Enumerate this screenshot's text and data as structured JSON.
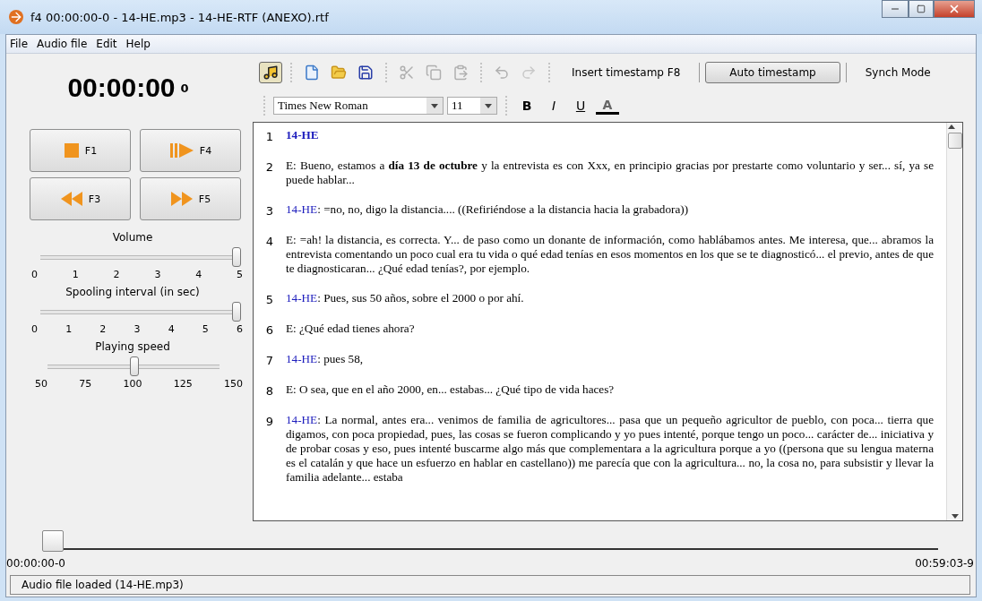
{
  "window": {
    "title": "f4 00:00:00-0 - 14-HE.mp3 - 14-HE-RTF (ANEXO).rtf"
  },
  "menu": [
    "File",
    "Audio file",
    "Edit",
    "Help"
  ],
  "timer": {
    "time": "00:00:00",
    "tenths": "0"
  },
  "transport": [
    {
      "kind": "stop",
      "label": "F1"
    },
    {
      "kind": "play",
      "label": "F4"
    },
    {
      "kind": "rewind",
      "label": "F3"
    },
    {
      "kind": "forward",
      "label": "F5"
    }
  ],
  "sliders": [
    {
      "label": "Volume",
      "level": 1,
      "ticks": [
        "0",
        "1",
        "2",
        "3",
        "4",
        "5"
      ]
    },
    {
      "label": "Spooling interval (in sec)",
      "level": 1,
      "ticks": [
        "0",
        "1",
        "2",
        "3",
        "4",
        "5",
        "6"
      ]
    },
    {
      "label": "Playing speed",
      "level": 0.5,
      "ticks": [
        "50",
        "75",
        "100",
        "125",
        "150"
      ]
    }
  ],
  "toolbar": [
    {
      "kind": "load-audio",
      "selected": true,
      "disabled": false
    },
    {
      "kind": "sep"
    },
    {
      "kind": "new",
      "selected": false,
      "disabled": false
    },
    {
      "kind": "open",
      "selected": false,
      "disabled": false
    },
    {
      "kind": "save",
      "selected": false,
      "disabled": false
    },
    {
      "kind": "sep"
    },
    {
      "kind": "cut",
      "selected": false,
      "disabled": true
    },
    {
      "kind": "copy",
      "selected": false,
      "disabled": true
    },
    {
      "kind": "paste",
      "selected": false,
      "disabled": true
    },
    {
      "kind": "sep"
    },
    {
      "kind": "undo",
      "selected": false,
      "disabled": true
    },
    {
      "kind": "redo",
      "selected": false,
      "disabled": true
    },
    {
      "kind": "sep"
    },
    {
      "kind": "text",
      "label": "Insert timestamp F8",
      "selected": false
    },
    {
      "kind": "bar"
    },
    {
      "kind": "text",
      "label": "Auto timestamp",
      "selected": true
    },
    {
      "kind": "bar"
    },
    {
      "kind": "text",
      "label": "Synch Mode",
      "selected": false
    }
  ],
  "format": {
    "font": "Times New Roman",
    "size": "11",
    "styles": [
      {
        "kind": "bold",
        "label": "B"
      },
      {
        "kind": "italic",
        "label": "I"
      },
      {
        "kind": "underline",
        "label": "U"
      },
      {
        "kind": "color",
        "label": "A"
      }
    ]
  },
  "paragraphs": [
    {
      "number": "1",
      "kind": "heading",
      "text": "14-HE"
    },
    {
      "number": "2",
      "kind": "plain",
      "text": "E: Bueno, estamos a **día 13 de octubre** y la entrevista es con Xxx, en principio gracias por prestarte como voluntario y ser... sí, ya se puede hablar..."
    },
    {
      "number": "3",
      "kind": "speaker",
      "speaker": "14-HE",
      "text": ": =no, no, digo la distancia.... ((Refiriéndose a la distancia hacia la grabadora))"
    },
    {
      "number": "4",
      "kind": "plain",
      "text": "E: =ah! la distancia, es correcta. Y... de paso como un donante de información, como hablábamos antes. Me interesa, que... abramos la entrevista comentando un poco cual era tu vida o qué edad tenías en esos momentos en los que se te diagnosticó... el previo, antes de que te diagnosticaran... ¿Qué edad tenías?, por ejemplo."
    },
    {
      "number": "5",
      "kind": "speaker",
      "speaker": "14-HE",
      "text": ": Pues, sus 50 años, sobre el 2000 o por ahí."
    },
    {
      "number": "6",
      "kind": "plain",
      "text": "E: ¿Qué edad tienes ahora?"
    },
    {
      "number": "7",
      "kind": "speaker",
      "speaker": "14-HE",
      "text": ": pues 58,"
    },
    {
      "number": "8",
      "kind": "plain",
      "text": "E: O sea, que en el año 2000, en... estabas... ¿Qué tipo de vida haces?"
    },
    {
      "number": "9",
      "kind": "speaker",
      "speaker": "14-HE",
      "text": ": La normal, antes era... venimos de familia de agricultores... pasa que un pequeño agricultor de pueblo, con poca... tierra que digamos, con poca propiedad, pues, las cosas se fueron complicando y yo pues intenté, porque tengo un poco... carácter de... iniciativa y de probar cosas y eso, pues intenté buscarme algo más que complementara a la agricultura porque a yo ((persona que su lengua materna es el catalán y que hace un esfuerzo en hablar en castellano)) me parecía que con la agricultura... no, la cosa no, para subsistir y llevar la familia adelante... estaba"
    }
  ],
  "position": {
    "level": 0,
    "start": "00:00:00-0",
    "end": "00:59:03-9"
  },
  "status_bar": "Audio file loaded (14-HE.mp3)"
}
